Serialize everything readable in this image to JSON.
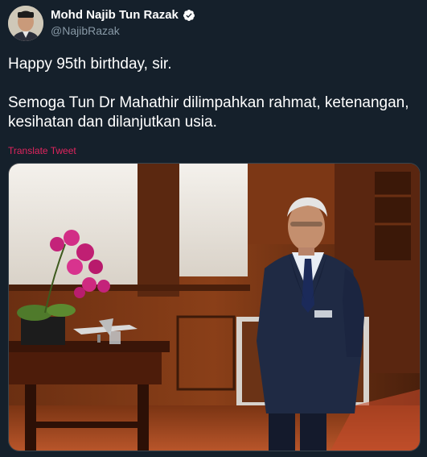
{
  "author": {
    "display_name": "Mohd Najib Tun Razak",
    "handle": "@NajibRazak",
    "avatar_icon": "user-avatar-photo",
    "verified_icon": "verified-badge-icon"
  },
  "tweet": {
    "line1": "Happy 95th birthday, sir.",
    "line2": "Semoga Tun Dr Mahathir dilimpahkan rahmat, ketenangan, kesihatan dan dilanjutkan usia.",
    "translate_label": "Translate Tweet"
  },
  "media": {
    "description_icon": "tweet-photo"
  },
  "colors": {
    "background": "#15202b",
    "text_primary": "#ffffff",
    "text_secondary": "#8899a6",
    "translate_link": "#e0245e",
    "verified_blue": "#ffffff"
  }
}
